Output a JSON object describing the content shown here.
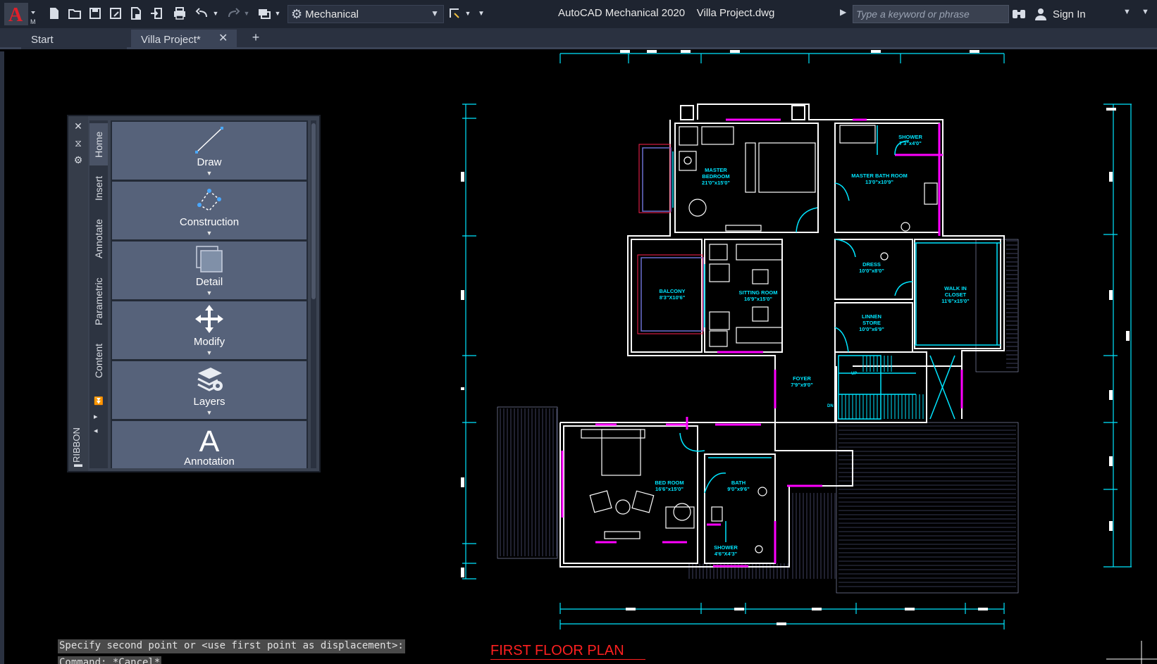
{
  "app": {
    "title": "AutoCAD Mechanical 2020",
    "file": "Villa Project.dwg",
    "workspace": "Mechanical",
    "search_placeholder": "Type a keyword or phrase",
    "sign_in": "Sign In"
  },
  "quick_access": [
    "new-icon",
    "open-icon",
    "save-icon",
    "save-as-icon",
    "publish-icon",
    "import-icon",
    "print-icon",
    "undo-icon",
    "redo-icon",
    "workspace-switch-icon"
  ],
  "tabs": [
    {
      "label": "Start"
    },
    {
      "label": "Villa Project*"
    }
  ],
  "ribbon": {
    "label": "RIBBON",
    "tabs": [
      "Home",
      "Insert",
      "Annotate",
      "Parametric",
      "Content"
    ],
    "panels": [
      {
        "label": "Draw",
        "icon": "line-icon"
      },
      {
        "label": "Construction",
        "icon": "construction-icon"
      },
      {
        "label": "Detail",
        "icon": "detail-icon"
      },
      {
        "label": "Modify",
        "icon": "move-arrows-icon"
      },
      {
        "label": "Layers",
        "icon": "layers-icon"
      },
      {
        "label": "Annotation",
        "icon": "annotation-icon"
      }
    ]
  },
  "drawing": {
    "plan_title": "FIRST FLOOR PLAN",
    "rooms": [
      {
        "name": "MASTER BEDROOM",
        "dim": "21'0\"x15'0\""
      },
      {
        "name": "MASTER BATH ROOM",
        "dim": "13'0\"x10'9\""
      },
      {
        "name": "SHOWER",
        "dim": "7'3\"x4'0\""
      },
      {
        "name": "BALCONY",
        "dim": "8'3\"X10'6\""
      },
      {
        "name": "SITTING ROOM",
        "dim": "16'9\"x15'0\""
      },
      {
        "name": "DRESS",
        "dim": "10'0\"x8'0\""
      },
      {
        "name": "WALK IN CLOSET",
        "dim": "11'6\"x15'0\""
      },
      {
        "name": "LINNEN STORE",
        "dim": "10'0\"x6'9\""
      },
      {
        "name": "FOYER",
        "dim": "7'9\"x9'0\""
      },
      {
        "name": "BED ROOM",
        "dim": "16'6\"x15'0\""
      },
      {
        "name": "BATH",
        "dim": "9'0\"x9'6\""
      },
      {
        "name": "SHOWER",
        "dim": "4'6\"X4'3\""
      }
    ],
    "stair_labels": [
      "UP",
      "DN"
    ]
  },
  "command_line": [
    "Specify second point or <use first point as displacement>:",
    "Command: *Cancel*"
  ],
  "colors": {
    "titlebar": "#1e2430",
    "tabbar": "#2a3140",
    "wall": "#ffffff",
    "dimension": "#00e5ff",
    "door_window": "#ff00ff",
    "title_red": "#ff2020"
  }
}
